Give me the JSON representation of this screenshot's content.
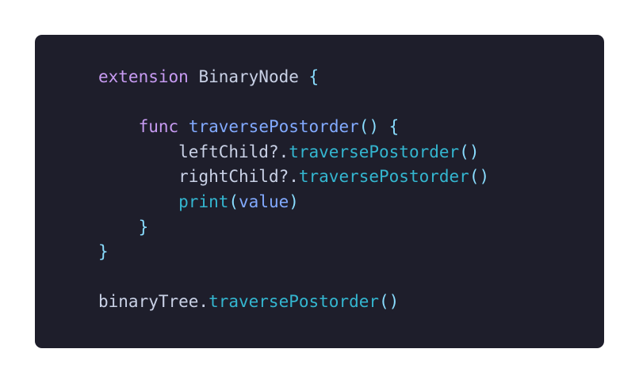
{
  "code": {
    "lines": [
      [
        {
          "text": "extension",
          "kind": "kw"
        },
        {
          "text": " ",
          "kind": "plain"
        },
        {
          "text": "BinaryNode",
          "kind": "type"
        },
        {
          "text": " ",
          "kind": "plain"
        },
        {
          "text": "{",
          "kind": "brace"
        }
      ],
      [],
      [
        {
          "text": "    ",
          "kind": "plain"
        },
        {
          "text": "func",
          "kind": "kw"
        },
        {
          "text": " ",
          "kind": "plain"
        },
        {
          "text": "traversePostorder",
          "kind": "fn"
        },
        {
          "text": "() {",
          "kind": "punc"
        }
      ],
      [
        {
          "text": "        ",
          "kind": "plain"
        },
        {
          "text": "leftChild?.",
          "kind": "plain"
        },
        {
          "text": "traversePostorder",
          "kind": "call"
        },
        {
          "text": "()",
          "kind": "punc"
        }
      ],
      [
        {
          "text": "        ",
          "kind": "plain"
        },
        {
          "text": "rightChild?.",
          "kind": "plain"
        },
        {
          "text": "traversePostorder",
          "kind": "call"
        },
        {
          "text": "()",
          "kind": "punc"
        }
      ],
      [
        {
          "text": "        ",
          "kind": "plain"
        },
        {
          "text": "print",
          "kind": "call"
        },
        {
          "text": "(",
          "kind": "punc"
        },
        {
          "text": "value",
          "kind": "fn"
        },
        {
          "text": ")",
          "kind": "punc"
        }
      ],
      [
        {
          "text": "    ",
          "kind": "plain"
        },
        {
          "text": "}",
          "kind": "punc"
        }
      ],
      [
        {
          "text": "}",
          "kind": "brace"
        }
      ],
      [],
      [
        {
          "text": "binaryTree.",
          "kind": "plain"
        },
        {
          "text": "traversePostorder",
          "kind": "call"
        },
        {
          "text": "()",
          "kind": "punc"
        }
      ]
    ]
  }
}
